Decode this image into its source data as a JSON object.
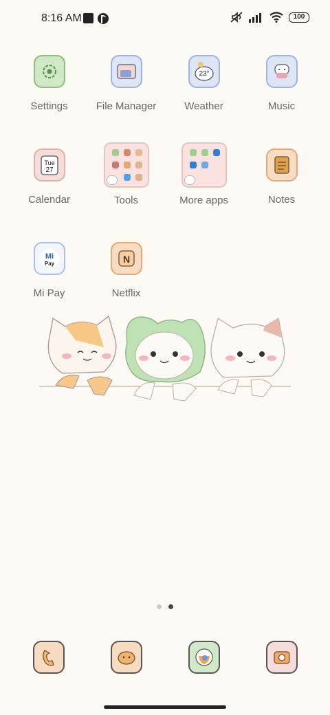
{
  "status_bar": {
    "time": "8:16 AM",
    "battery": "100",
    "icons": [
      "notification-square-icon",
      "app-circle-icon",
      "mute-icon",
      "signal-icon",
      "wifi-icon",
      "battery-icon"
    ]
  },
  "apps": [
    {
      "name": "settings",
      "label": "Settings",
      "icon": "gear-icon"
    },
    {
      "name": "file-manager",
      "label": "File Manager",
      "icon": "folder-icon"
    },
    {
      "name": "weather",
      "label": "Weather",
      "icon": "weather-icon",
      "icon_text": "23°"
    },
    {
      "name": "music",
      "label": "Music",
      "icon": "music-icon"
    },
    {
      "name": "calendar",
      "label": "Calendar",
      "icon": "calendar-icon",
      "icon_text_day": "Tue",
      "icon_text_date": "27"
    },
    {
      "name": "tools",
      "label": "Tools",
      "icon": "folder-grid-icon"
    },
    {
      "name": "more-apps",
      "label": "More apps",
      "icon": "folder-grid-icon"
    },
    {
      "name": "notes",
      "label": "Notes",
      "icon": "notepad-icon"
    },
    {
      "name": "mi-pay",
      "label": "Mi Pay",
      "icon": "mi-pay-icon",
      "icon_text_top": "Mi",
      "icon_text_bottom": "Pay"
    },
    {
      "name": "netflix",
      "label": "Netflix",
      "icon": "netflix-icon",
      "icon_text": "N"
    }
  ],
  "pager": {
    "pages": 2,
    "current": 2
  },
  "dock": [
    {
      "name": "phone",
      "icon": "phone-icon"
    },
    {
      "name": "messages",
      "icon": "messages-icon"
    },
    {
      "name": "browser",
      "icon": "browser-icon"
    },
    {
      "name": "camera",
      "icon": "camera-icon"
    }
  ]
}
